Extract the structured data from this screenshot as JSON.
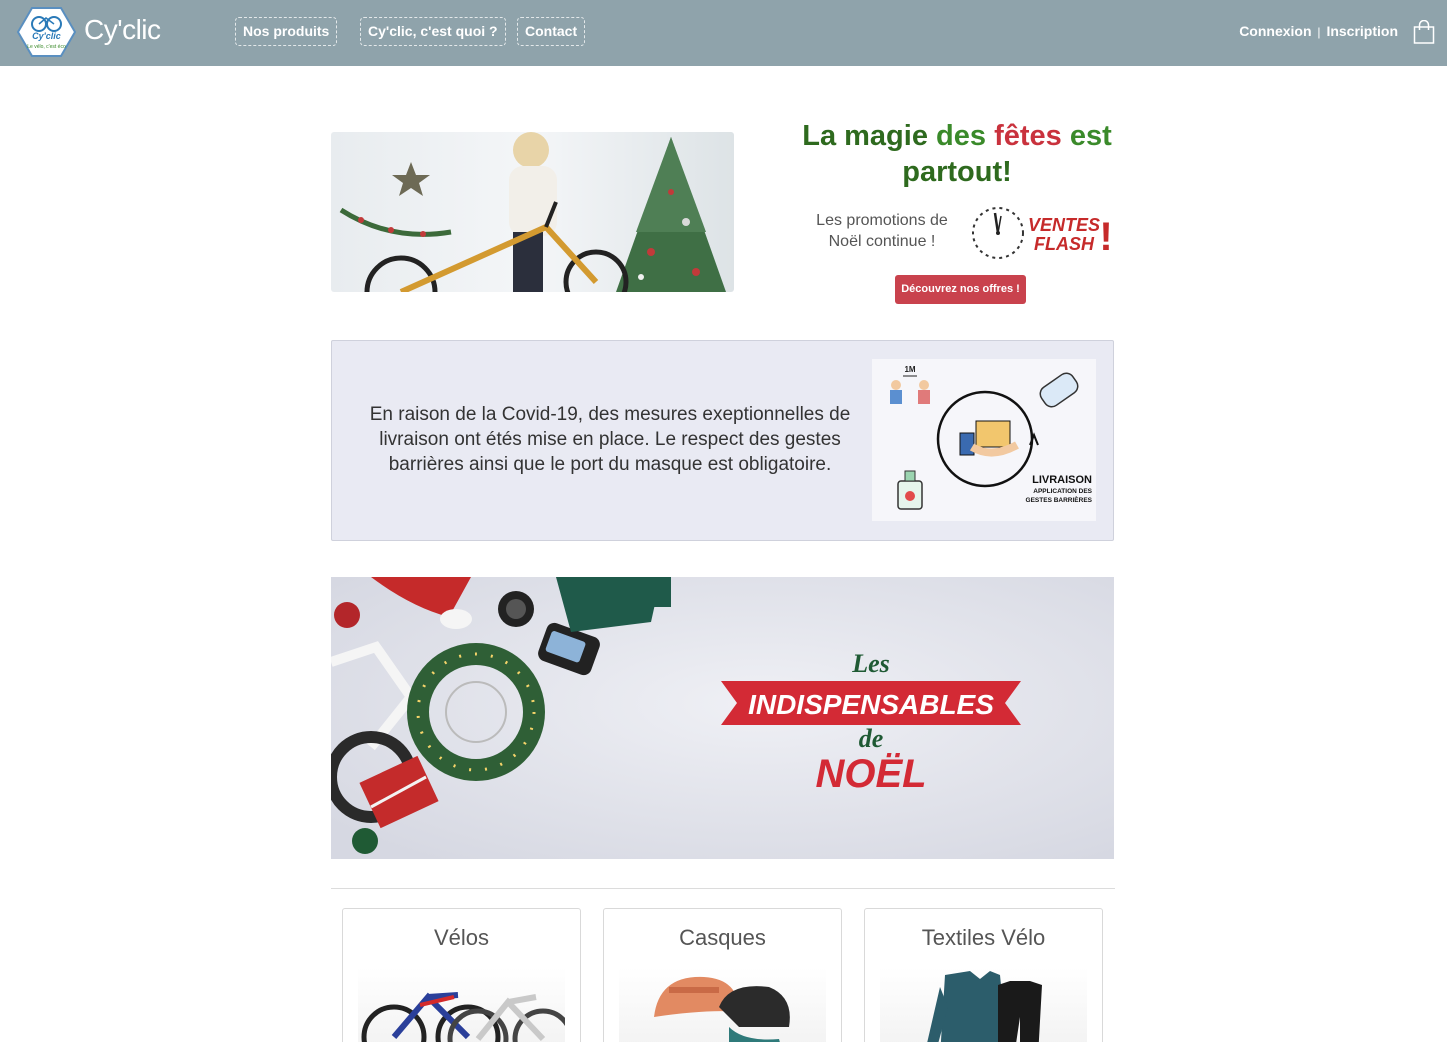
{
  "header": {
    "brand": "Cy'clic",
    "logo_text": "Cy'clic",
    "logo_tagline": "Le vélo, c'est éco",
    "nav": [
      "Nos produits",
      "Cy'clic, c'est quoi ?",
      "Contact"
    ],
    "login": "Connexion",
    "separator": "|",
    "register": "Inscription",
    "cart_icon": "shopping-bag-icon"
  },
  "promo": {
    "title_words": [
      "La magie",
      "des",
      "fêtes",
      "est",
      "partout!"
    ],
    "text": "Les promotions de Noël continue !",
    "flash_line1": "VENTES",
    "flash_line2": "FLASH",
    "flash_mark": "!",
    "button": "Découvrez nos offres !"
  },
  "covid": {
    "text": "En raison de la Covid-19, des mesures exeptionnelles de livraison ont étés mise en place. Le respect des gestes barrières ainsi que le port du masque est obligatoire.",
    "distance_label": "1M",
    "illus_title": "LIVRAISON",
    "illus_sub1": "APPLICATION DES",
    "illus_sub2": "GESTES BARRIÈRES"
  },
  "banner": {
    "line1": "Les",
    "line2": "INDISPENSABLES",
    "line3": "de",
    "line4": "NOËL"
  },
  "categories": [
    {
      "title": "Vélos"
    },
    {
      "title": "Casques"
    },
    {
      "title": "Textiles Vélo"
    }
  ],
  "colors": {
    "navbar": "#8fa3ab",
    "green": "#3a8a2a",
    "dark_green": "#2e6a1e",
    "red": "#c9323d",
    "button": "#c9424d",
    "covid_bg": "#e9eaf3"
  }
}
